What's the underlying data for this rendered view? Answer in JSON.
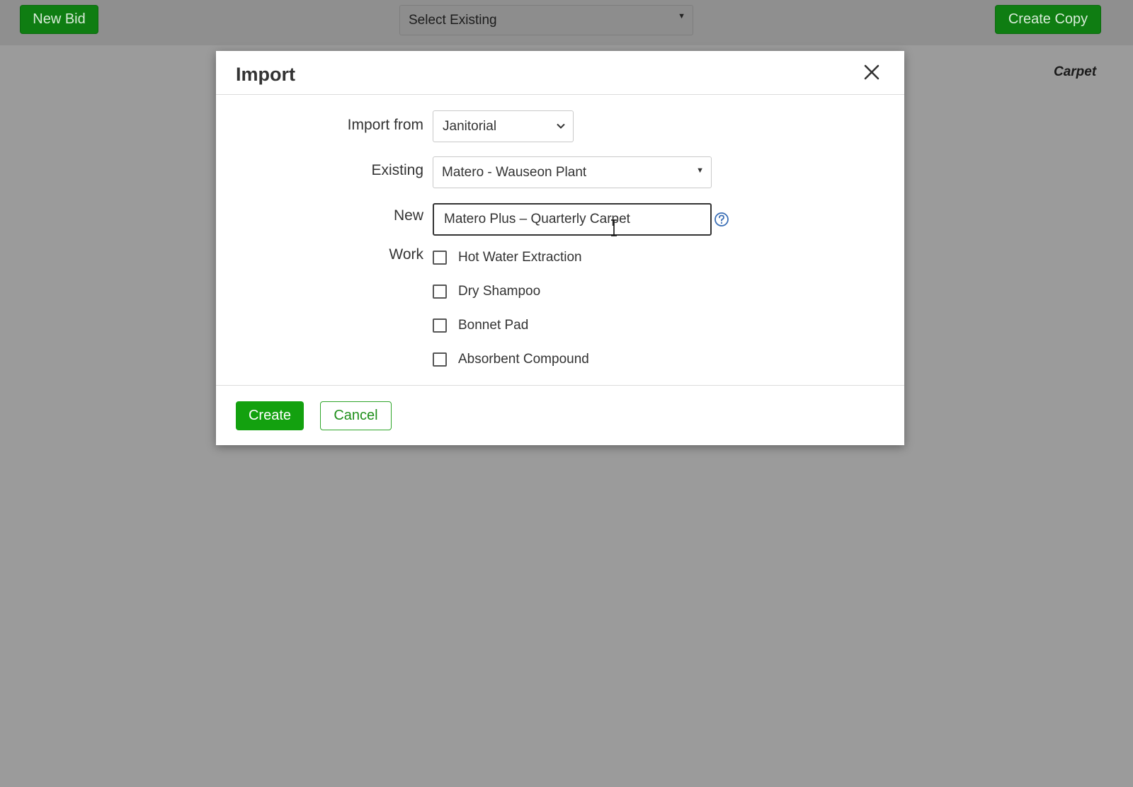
{
  "topbar": {
    "new_bid_label": "New Bid",
    "select_existing_placeholder": "Select Existing",
    "create_copy_label": "Create Copy"
  },
  "background": {
    "section_label": "Carpet"
  },
  "modal": {
    "title": "Import",
    "fields": {
      "import_from_label": "Import from",
      "import_from_value": "Janitorial",
      "existing_label": "Existing",
      "existing_value": "Matero - Wauseon Plant",
      "new_label": "New",
      "new_value": "Matero Plus – Quarterly Carpet",
      "work_label": "Work"
    },
    "work_options": [
      {
        "label": "Hot Water Extraction",
        "checked": false
      },
      {
        "label": "Dry Shampoo",
        "checked": false
      },
      {
        "label": "Bonnet Pad",
        "checked": false
      },
      {
        "label": "Absorbent Compound",
        "checked": false
      }
    ],
    "footer": {
      "create_label": "Create",
      "cancel_label": "Cancel"
    }
  },
  "colors": {
    "primary_green": "#13a10f",
    "overlay_gray": "#9b9b9b"
  },
  "icons": {
    "close": "close-icon",
    "help": "help-icon",
    "chevron": "chevron-down-icon"
  }
}
